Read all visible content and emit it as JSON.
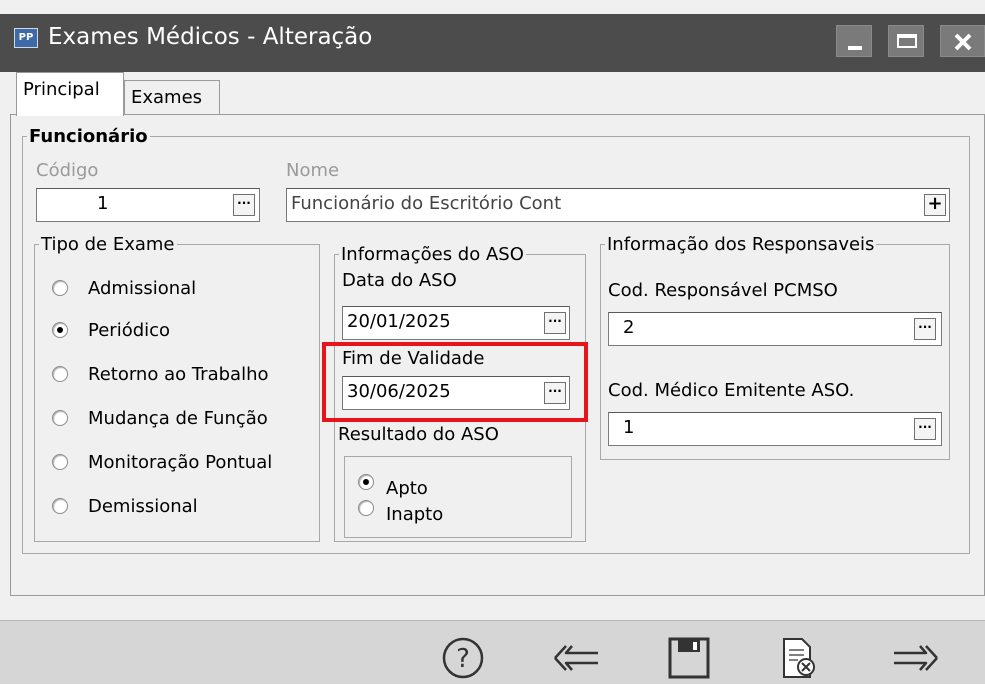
{
  "window": {
    "title": "Exames Médicos - Alteração",
    "icon_text": "PP"
  },
  "tabs": [
    {
      "label": "Principal"
    },
    {
      "label": "Exames"
    }
  ],
  "funcionario": {
    "legend": "Funcionário",
    "codigo_label": "Código",
    "codigo_value": "1",
    "nome_label": "Nome",
    "nome_value": "Funcionário do Escritório Cont"
  },
  "tipo_exame": {
    "legend": "Tipo de Exame",
    "options": [
      "Admissional",
      "Periódico",
      "Retorno ao Trabalho",
      "Mudança de Função",
      "Monitoração Pontual",
      "Demissional"
    ],
    "selected": "Periódico"
  },
  "aso": {
    "legend": "Informações do ASO",
    "data_label": "Data do ASO",
    "data_value": "20/01/2025",
    "fim_label": "Fim de Validade",
    "fim_value": "30/06/2025",
    "resultado_label": "Resultado do ASO",
    "resultado_options": [
      "Apto",
      "Inapto"
    ],
    "resultado_selected": "Apto"
  },
  "responsaveis": {
    "legend": "Informação dos Responsaveis",
    "pcmso_label": "Cod. Responsável PCMSO",
    "pcmso_value": "2",
    "medico_label": "Cod. Médico Emitente ASO.",
    "medico_value": "1"
  },
  "toolbar": {
    "icons": [
      "help-icon",
      "back-arrow-icon",
      "save-icon",
      "cancel-document-icon",
      "forward-arrow-icon"
    ]
  },
  "colors": {
    "titlebar": "#4c4c4c",
    "highlight": "#e8141b",
    "panel": "#f0f0f0"
  }
}
